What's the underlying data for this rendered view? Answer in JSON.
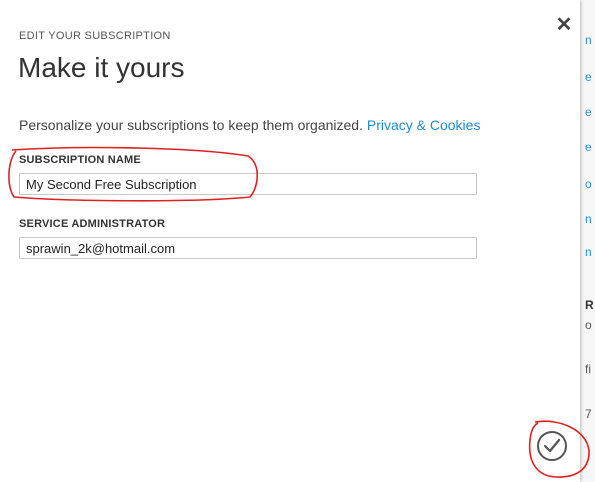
{
  "dialog": {
    "eyebrow": "EDIT YOUR SUBSCRIPTION",
    "title": "Make it yours",
    "description": "Personalize your subscriptions to keep them organized.",
    "privacy_link": "Privacy & Cookies",
    "subscription_name": {
      "label": "SUBSCRIPTION NAME",
      "value": "My Second Free Subscription"
    },
    "service_administrator": {
      "label": "SERVICE ADMINISTRATOR",
      "value": "sprawin_2k@hotmail.com"
    },
    "close_icon": "close-icon",
    "confirm_icon": "checkmark-icon"
  },
  "background_fragments": [
    "n",
    "e",
    "e",
    "e",
    "o",
    "n",
    "n",
    "R",
    "o",
    "fi",
    "7"
  ],
  "colors": {
    "link": "#1e8ad6",
    "annotation": "#e02020"
  }
}
